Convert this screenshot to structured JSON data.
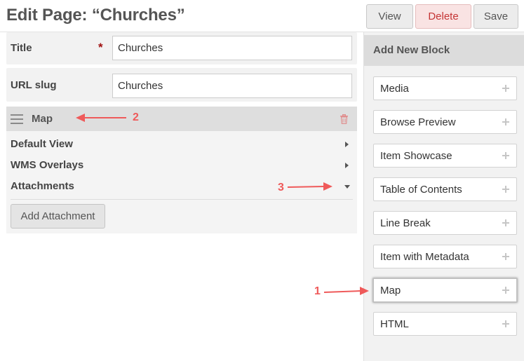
{
  "page": {
    "title": "Edit Page: “Churches”"
  },
  "toolbar": {
    "view_label": "View",
    "delete_label": "Delete",
    "save_label": "Save"
  },
  "form": {
    "title_label": "Title",
    "title_required_mark": "*",
    "title_value": "Churches",
    "slug_label": "URL slug",
    "slug_value": "Churches"
  },
  "block": {
    "title": "Map",
    "sections": [
      {
        "label": "Default View",
        "state": "collapsed"
      },
      {
        "label": "WMS Overlays",
        "state": "collapsed"
      },
      {
        "label": "Attachments",
        "state": "expanded"
      }
    ],
    "add_attachment_label": "Add Attachment"
  },
  "sidebar": {
    "title": "Add New Block",
    "items": [
      {
        "label": "Media"
      },
      {
        "label": "Browse Preview"
      },
      {
        "label": "Item Showcase"
      },
      {
        "label": "Table of Contents"
      },
      {
        "label": "Line Break"
      },
      {
        "label": "Item with Metadata"
      },
      {
        "label": "Map",
        "selected": true
      },
      {
        "label": "HTML"
      }
    ]
  },
  "annotations": {
    "color": "#ef5a5a",
    "numbers": [
      "1",
      "2",
      "3"
    ]
  },
  "colors": {
    "delete_text": "#c53535",
    "required_star": "#a01010"
  }
}
